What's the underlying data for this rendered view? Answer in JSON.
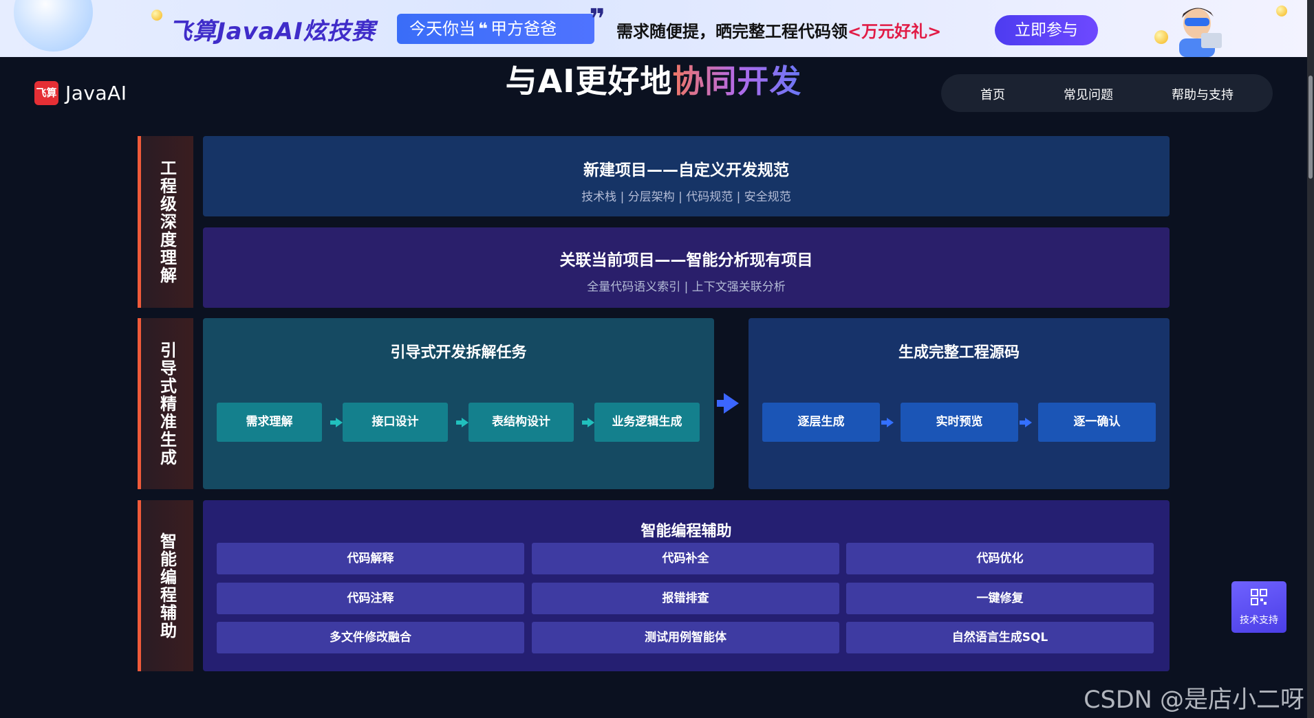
{
  "banner": {
    "title": "飞算JavaAI炫技赛",
    "pill_text": "今天你当",
    "pill_quote_open": "❝",
    "pill_highlight": "甲方爸爸",
    "pill_quote_close": "❞",
    "desc": "需求随便提，晒完整工程代码领",
    "desc_highlight": "<万元好礼>",
    "join_label": "立即参与"
  },
  "header": {
    "logo_mark": "飞算",
    "logo_text": "JavaAI",
    "hero_plain": "与AI更好地",
    "hero_gradient": "协同开发",
    "nav": [
      {
        "label": "首页"
      },
      {
        "label": "常见问题"
      },
      {
        "label": "帮助与支持"
      }
    ]
  },
  "sections": {
    "deep": {
      "label": "工程级深度理解",
      "cards": [
        {
          "title": "新建项目——自定义开发规范",
          "subtitle": "技术栈 | 分层架构 | 代码规范 | 安全规范"
        },
        {
          "title": "关联当前项目——智能分析现有项目",
          "subtitle": "全量代码语义索引 | 上下文强关联分析"
        }
      ]
    },
    "guided": {
      "label": "引导式精准生成",
      "left_title": "引导式开发拆解任务",
      "left_steps": [
        "需求理解",
        "接口设计",
        "表结构设计",
        "业务逻辑生成"
      ],
      "right_title": "生成完整工程源码",
      "right_steps": [
        "逐层生成",
        "实时预览",
        "逐一确认"
      ]
    },
    "assist": {
      "label": "智能编程辅助",
      "title": "智能编程辅助",
      "features": [
        "代码解释",
        "代码补全",
        "代码优化",
        "代码注释",
        "报错排查",
        "一键修复",
        "多文件修改融合",
        "测试用例智能体",
        "自然语言生成SQL"
      ]
    }
  },
  "support": {
    "label": "技术支持",
    "icon": "qr-code-icon"
  },
  "watermark": "CSDN @是店小二呀",
  "colors": {
    "background": "#0b1120",
    "accent_orange": "#f05a3a",
    "teal_step": "#14808d",
    "blue_step": "#1b55b6",
    "feature_tile": "#3e3ba2",
    "join_button": "#5a42f5"
  }
}
